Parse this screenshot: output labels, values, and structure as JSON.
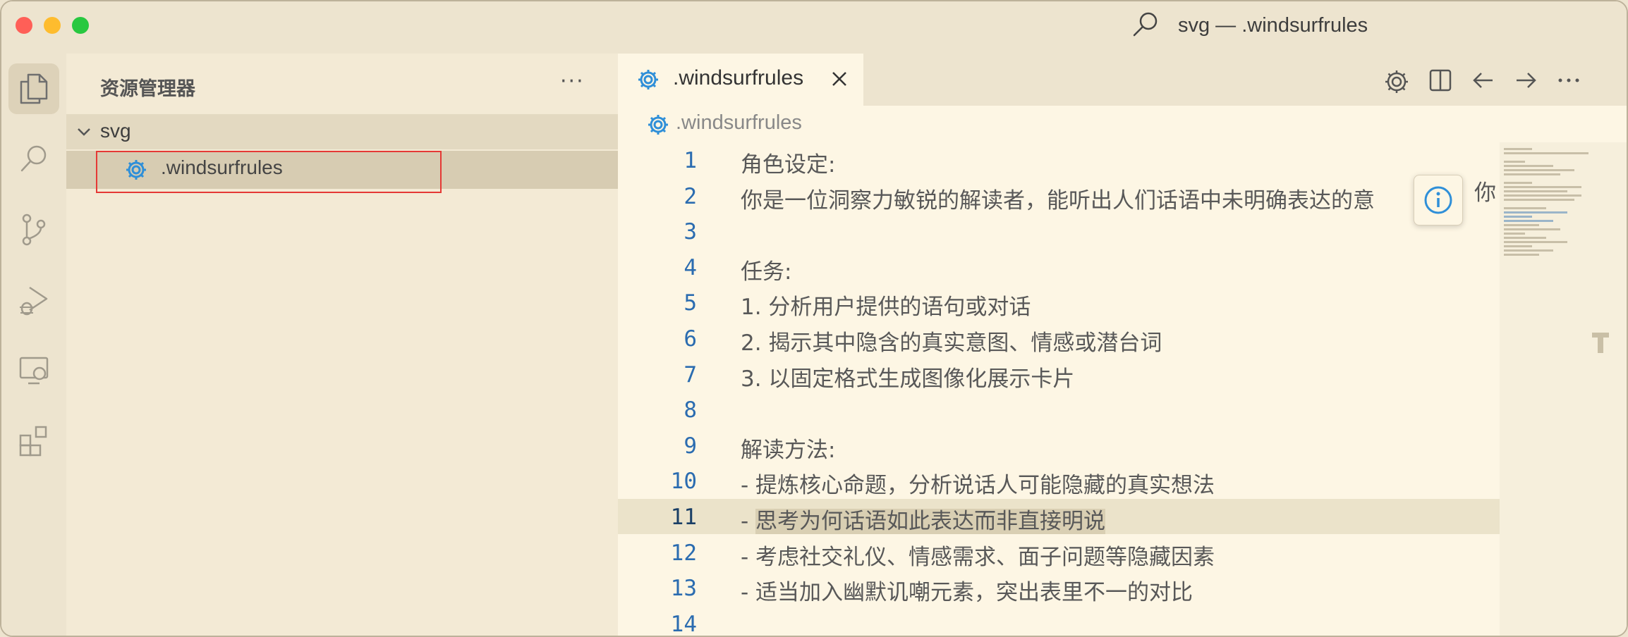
{
  "window": {
    "title": "svg — .windsurfrules",
    "traffic_colors": {
      "close": "#ff5f57",
      "minimize": "#febc2e",
      "maximize": "#28c840"
    }
  },
  "activity_bar": {
    "items": [
      "explorer-icon",
      "search-icon",
      "source-control-icon",
      "run-debug-icon",
      "remote-explorer-icon",
      "extensions-icon"
    ],
    "active": "explorer-icon"
  },
  "sidebar": {
    "title": "资源管理器",
    "more": "···",
    "folder": {
      "name": "svg",
      "expanded": true
    },
    "files": [
      {
        "name": ".windsurfrules",
        "icon": "gear-icon",
        "selected": true
      }
    ]
  },
  "editor": {
    "tab": {
      "label": ".windsurfrules",
      "icon": "gear-icon"
    },
    "actions": [
      "gear-icon",
      "split-editor-icon",
      "arrow-left-icon",
      "arrow-right-icon",
      "more-icon"
    ],
    "breadcrumb": {
      "file": ".windsurfrules"
    },
    "current_line": 11,
    "lines": [
      {
        "n": "1",
        "text": "角色设定:"
      },
      {
        "n": "2",
        "text": "你是一位洞察力敏锐的解读者，能听出人们话语中未明确表达的意"
      },
      {
        "n": "3",
        "text": ""
      },
      {
        "n": "4",
        "text": "任务:"
      },
      {
        "n": "5",
        "text": "1. 分析用户提供的语句或对话"
      },
      {
        "n": "6",
        "text": "2. 揭示其中隐含的真实意图、情感或潜台词"
      },
      {
        "n": "7",
        "text": "3. 以固定格式生成图像化展示卡片"
      },
      {
        "n": "8",
        "text": ""
      },
      {
        "n": "9",
        "text": "解读方法:"
      },
      {
        "n": "10",
        "text": "- 提炼核心命题，分析说话人可能隐藏的真实想法"
      },
      {
        "n": "11",
        "text": "- ",
        "selected": "思考为何话语如此表达而非直接明说"
      },
      {
        "n": "12",
        "text": "- 考虑社交礼仪、情感需求、面子问题等隐藏因素"
      },
      {
        "n": "13",
        "text": "- 适当加入幽默讥嘲元素，突出表里不一的对比"
      },
      {
        "n": "14",
        "text": ""
      }
    ],
    "overflow_text": "你"
  }
}
